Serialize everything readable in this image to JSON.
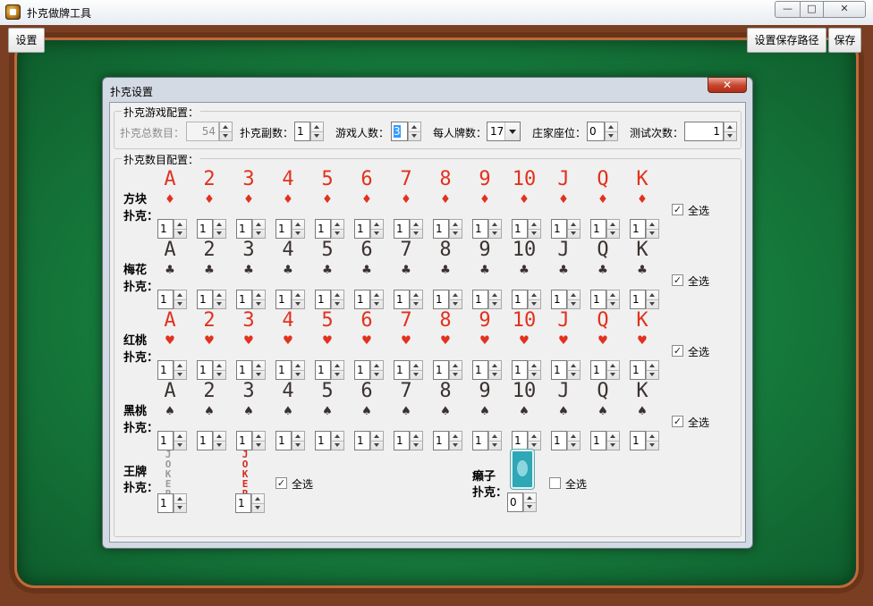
{
  "window": {
    "title": "扑克做牌工具",
    "min": "—",
    "max": "□",
    "close": "✕",
    "icon": "poker-app-icon"
  },
  "toolbar": {
    "settings": "设置",
    "path": "设置保存路径",
    "save": "保存"
  },
  "dialog": {
    "title": "扑克设置",
    "close": "✕",
    "game": {
      "title": "扑克游戏配置：",
      "total_label": "扑克总数目：",
      "total_value": "54",
      "decks_label": "扑克副数：",
      "decks_value": "1",
      "players_label": "游戏人数：",
      "players_value": "3",
      "per_label": "每人牌数：",
      "per_value": "17",
      "dealer_label": "庄家座位：",
      "dealer_value": "0",
      "test_label": "测试次数：",
      "test_value": "1"
    },
    "counts": {
      "title": "扑克数目配置：",
      "ranks": [
        "A",
        "2",
        "3",
        "4",
        "5",
        "6",
        "7",
        "8",
        "9",
        "10",
        "J",
        "Q",
        "K"
      ],
      "select_all": "全选",
      "rows": [
        {
          "name1": "方块",
          "name2": "扑克：",
          "suit": "♦",
          "red": true,
          "checked": true,
          "values": [
            "1",
            "1",
            "1",
            "1",
            "1",
            "1",
            "1",
            "1",
            "1",
            "1",
            "1",
            "1",
            "1"
          ]
        },
        {
          "name1": "梅花",
          "name2": "扑克：",
          "suit": "♣",
          "red": false,
          "checked": true,
          "values": [
            "1",
            "1",
            "1",
            "1",
            "1",
            "1",
            "1",
            "1",
            "1",
            "1",
            "1",
            "1",
            "1"
          ]
        },
        {
          "name1": "红桃",
          "name2": "扑克：",
          "suit": "♥",
          "red": true,
          "checked": true,
          "values": [
            "1",
            "1",
            "1",
            "1",
            "1",
            "1",
            "1",
            "1",
            "1",
            "1",
            "1",
            "1",
            "1"
          ]
        },
        {
          "name1": "黑桃",
          "name2": "扑克：",
          "suit": "♠",
          "red": false,
          "checked": true,
          "values": [
            "1",
            "1",
            "1",
            "1",
            "1",
            "1",
            "1",
            "1",
            "1",
            "1",
            "1",
            "1",
            "1"
          ]
        }
      ],
      "joker": {
        "name1": "王牌",
        "name2": "扑克：",
        "small_text": "JOKER",
        "small_value": "1",
        "big_text": "JOKER",
        "big_value": "1",
        "checked": true
      },
      "laizi": {
        "name1": "癞子",
        "name2": "扑克：",
        "value": "0",
        "checked": false
      }
    }
  },
  "colors": {
    "red_suit": "#e2311e",
    "black_suit": "#3a3230",
    "felt": "#167a3c",
    "table_rim": "#7a3f22"
  }
}
